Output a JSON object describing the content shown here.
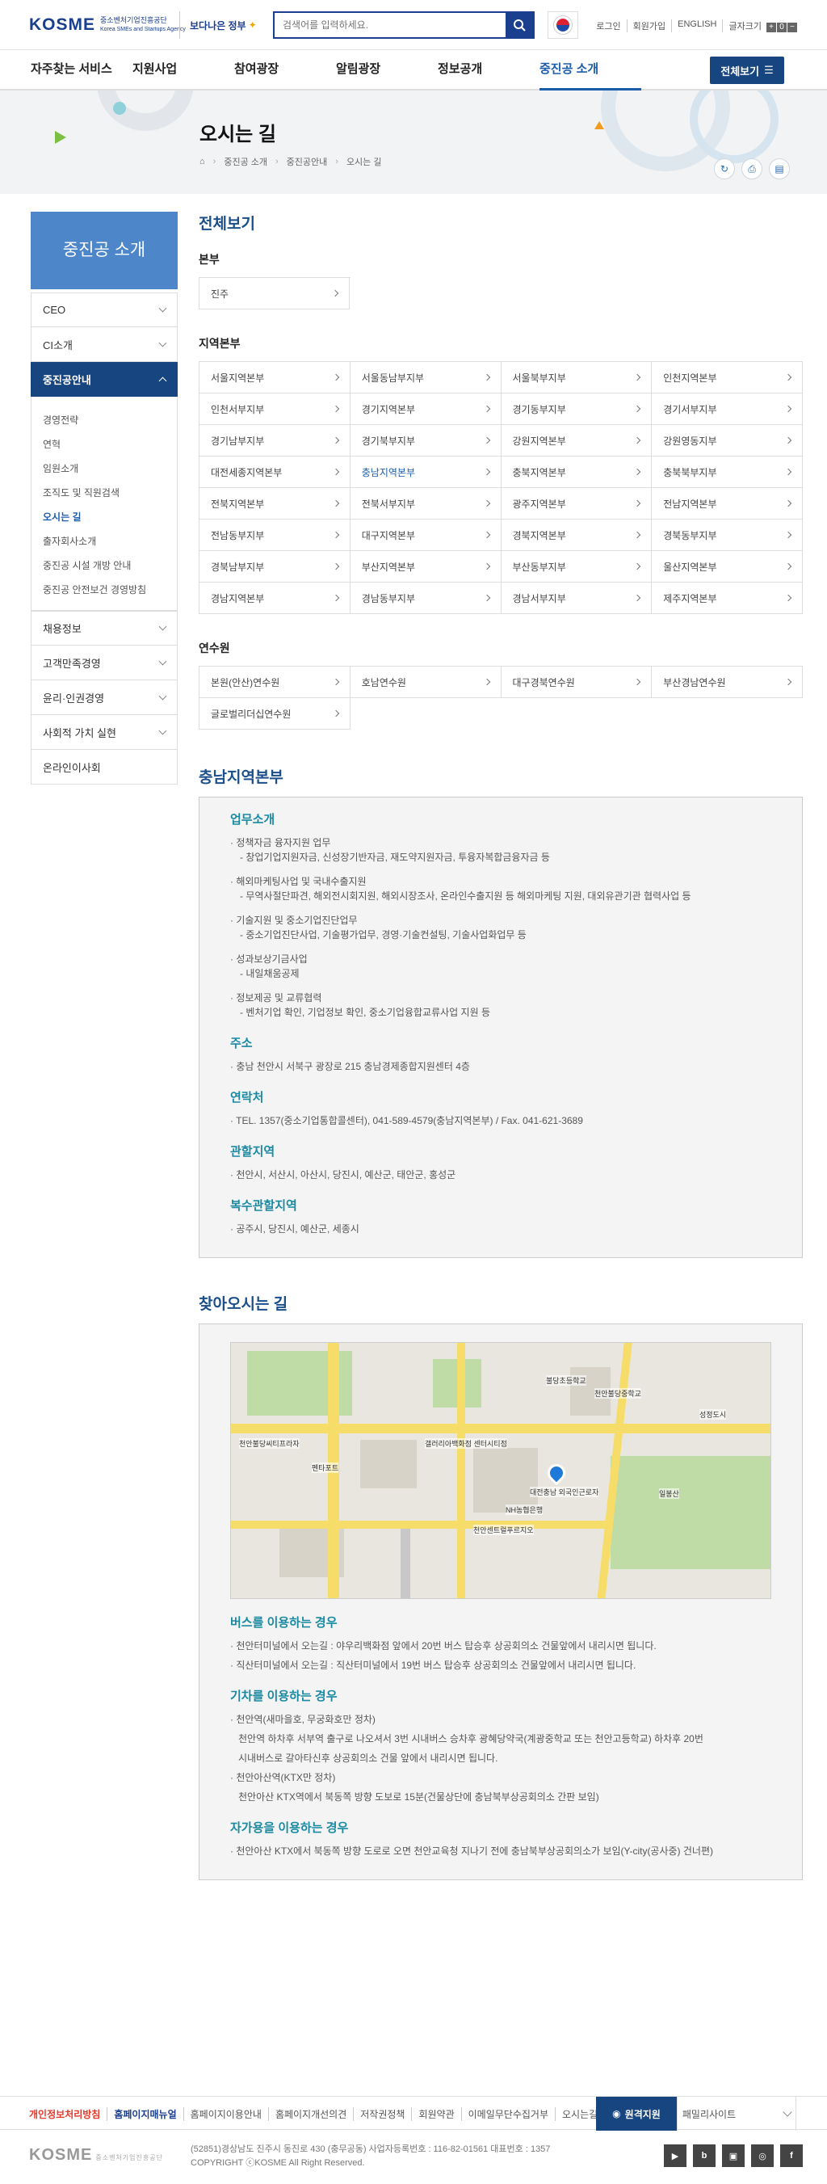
{
  "header": {
    "logo_text": "KOSME",
    "logo_sub": "중소벤처기업진흥공단",
    "logo_sub_en": "Korea SMEs and Startups Agency",
    "slogan": "보다나은 정부",
    "search_placeholder": "검색어를 입력하세요.",
    "util": [
      "로그인",
      "회원가입",
      "ENGLISH",
      "글자크기"
    ],
    "zoom": [
      "+",
      "0",
      "−"
    ]
  },
  "gnb": {
    "items": [
      "자주찾는 서비스",
      "지원사업",
      "참여광장",
      "알림광장",
      "정보공개",
      "중진공 소개"
    ],
    "active": "중진공 소개",
    "all_label": "전체보기"
  },
  "visual": {
    "title": "오시는 길",
    "breadcrumb": [
      "중진공 소개",
      "중진공안내",
      "오시는 길"
    ]
  },
  "lnb": {
    "title": "중진공 소개",
    "items_top": [
      "CEO",
      "CI소개"
    ],
    "active": "중진공안내",
    "sub": [
      "경영전략",
      "연혁",
      "임원소개",
      "조직도 및 직원검색",
      "오시는 길",
      "출자회사소개",
      "중진공 시설 개방 안내",
      "중진공 안전보건 경영방침"
    ],
    "sub_active": "오시는 길",
    "items_bottom": [
      "채용정보",
      "고객만족경영",
      "윤리·인권경영",
      "사회적 가치 실현",
      "온라인이사회"
    ]
  },
  "content": {
    "title": "전체보기",
    "hq_title": "본부",
    "hq": [
      "진주"
    ],
    "region_title": "지역본부",
    "regions": [
      "서울지역본부",
      "서울동남부지부",
      "서울북부지부",
      "인천지역본부",
      "인천서부지부",
      "경기지역본부",
      "경기동부지부",
      "경기서부지부",
      "경기남부지부",
      "경기북부지부",
      "강원지역본부",
      "강원영동지부",
      "대전세종지역본부",
      "충남지역본부",
      "충북지역본부",
      "충북북부지부",
      "전북지역본부",
      "전북서부지부",
      "광주지역본부",
      "전남지역본부",
      "전남동부지부",
      "대구지역본부",
      "경북지역본부",
      "경북동부지부",
      "경북남부지부",
      "부산지역본부",
      "부산동부지부",
      "울산지역본부",
      "경남지역본부",
      "경남동부지부",
      "경남서부지부",
      "제주지역본부"
    ],
    "region_active": "충남지역본부",
    "training_title": "연수원",
    "training": [
      "본원(안산)연수원",
      "호남연수원",
      "대구경북연수원",
      "부산경남연수원",
      "글로벌리더십연수원"
    ]
  },
  "office": {
    "title": "충남지역본부",
    "work_title": "업무소개",
    "work": [
      {
        "main": "정책자금 융자지원 업무",
        "sub": "창업기업지원자금, 신성장기반자금, 재도약지원자금, 투융자복합금융자금 등"
      },
      {
        "main": "해외마케팅사업 및 국내수출지원",
        "sub": "무역사절단파견, 해외전시회지원, 해외시장조사, 온라인수출지원 등 해외마케팅 지원, 대외유관기관 협력사업 등"
      },
      {
        "main": "기술지원 및 중소기업진단업무",
        "sub": "중소기업진단사업, 기술평가업무, 경영·기술컨설팅, 기술사업화업무 등"
      },
      {
        "main": "성과보상기금사업",
        "sub": "내일채움공제"
      },
      {
        "main": "정보제공 및 교류협력",
        "sub": "벤처기업 확인, 기업정보 확인, 중소기업융합교류사업 지원 등"
      }
    ],
    "addr_title": "주소",
    "addr": "충남 천안시 서북구 광장로 215 충남경제종합지원센터 4층",
    "contact_title": "연락처",
    "contact": "TEL. 1357(중소기업통합콜센터), 041-589-4579(충남지역본부) / Fax. 041-621-3689",
    "area_title": "관할지역",
    "area": "천안시, 서산시, 아산시, 당진시, 예산군, 태안군, 홍성군",
    "multi_title": "복수관할지역",
    "multi": "공주시, 당진시, 예산군, 세종시"
  },
  "directions": {
    "title": "찾아오시는 길",
    "bus_title": "버스를 이용하는 경우",
    "bus": [
      "천안터미널에서 오는길 : 야우리백화점 앞에서 20번 버스 탑승후 상공회의소 건물앞에서 내리시면 됩니다.",
      "직산터미널에서 오는길 : 직산터미널에서 19번 버스 탑승후 상공회의소 건물앞에서 내리시면 됩니다."
    ],
    "train_title": "기차를 이용하는 경우",
    "train": [
      "천안역(새마을호, 무궁화호만 정차)",
      "천안역 하차후 서부역 출구로 나오셔서 3번 시내버스 승차후 광혜당약국(계광중학교 또는 천안고등학교) 하차후 20번",
      "시내버스로 갈아타신후 상공회의소 건물 앞에서 내리시면 됩니다.",
      "천안아산역(KTX만 정차)",
      "천안아산 KTX역에서 북동쪽 방향 도보로 15분(건물상단에 충남북부상공회의소 간판 보임)"
    ],
    "car_title": "자가용을 이용하는 경우",
    "car": "천안아산 KTX에서 북동쪽 방향 도로로 오면 천안교육청 지나기 전에 충남북부상공회의소가 보임(Y-city(공사중) 건너편)",
    "map_labels": [
      "갤러리아백화점 센터시티점",
      "펜타포트",
      "천안불당씨티프라자",
      "천안센트럴푸르지오",
      "대전충남 외국인근로자",
      "NH농협은행",
      "불당초등학교",
      "천안불당중학교",
      "성정도시",
      "일봉산"
    ]
  },
  "footer": {
    "links": [
      "개인정보처리방침",
      "홈페이지매뉴얼",
      "홈페이지이용안내",
      "홈페이지개선의견",
      "저작권정책",
      "회원약관",
      "이메일무단수집거부",
      "오시는길"
    ],
    "remote": "원격지원",
    "family": "패밀리사이트",
    "logo": "KOSME",
    "address": "(52851)경상남도 진주시 동진로 430 (충무공동)   사업자등록번호 : 116-82-01561   대표번호 : 1357",
    "copyright": "COPYRIGHT ⓒKOSME All Right Reserved.",
    "sns": [
      "youtube-icon",
      "blog-icon",
      "post-icon",
      "instagram-icon",
      "facebook-icon"
    ]
  }
}
